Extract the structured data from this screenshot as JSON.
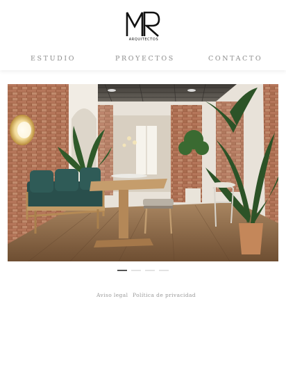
{
  "brand": {
    "logo_letters": "MR",
    "logo_subtitle": "ARQUITECTOS"
  },
  "nav": {
    "items": [
      {
        "label": "ESTUDIO"
      },
      {
        "label": "PROYECTOS"
      },
      {
        "label": "CONTACTO"
      }
    ]
  },
  "slider": {
    "slide_count": 4,
    "active_index": 0
  },
  "footer": {
    "links": [
      {
        "label": "Aviso legal"
      },
      {
        "label": "Política de privacidad"
      }
    ]
  },
  "colors": {
    "text_nav": "#8c8c8c",
    "dot_active": "#555555",
    "dot_inactive": "#e3e3e3"
  }
}
